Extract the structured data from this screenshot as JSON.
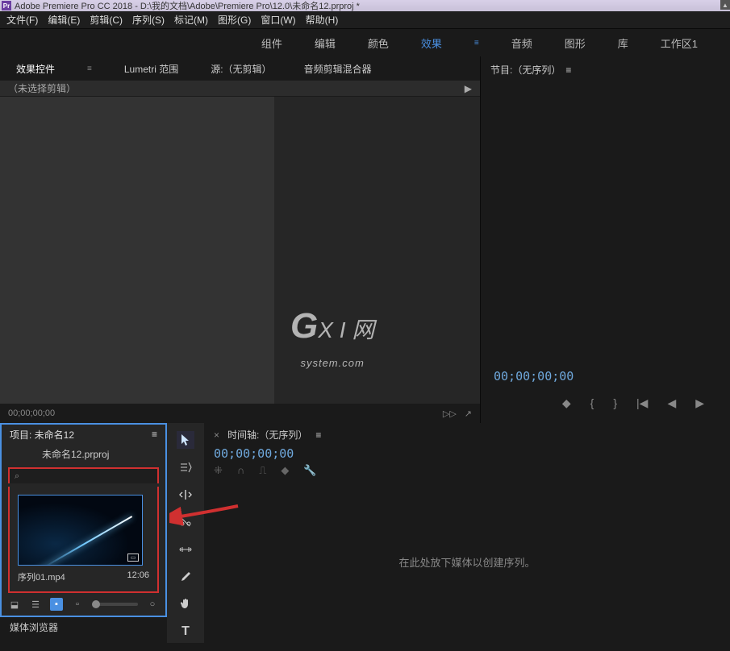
{
  "titlebar": {
    "app_badge": "Pr",
    "title": "Adobe Premiere Pro CC 2018 - D:\\我的文档\\Adobe\\Premiere Pro\\12.0\\未命名12.prproj *"
  },
  "menubar": {
    "file": "文件(F)",
    "edit": "编辑(E)",
    "clip": "剪辑(C)",
    "sequence": "序列(S)",
    "mark": "标记(M)",
    "graphic": "图形(G)",
    "window": "窗口(W)",
    "help": "帮助(H)"
  },
  "workspace": {
    "assembly": "组件",
    "editing": "编辑",
    "color": "颜色",
    "effects": "效果",
    "audio": "音频",
    "graphics": "图形",
    "library": "库",
    "workspace1": "工作区1"
  },
  "source_tabs": {
    "effect_controls": "效果控件",
    "lumetri": "Lumetri 范围",
    "source": "源:（无剪辑）",
    "audio_mixer": "音频剪辑混合器"
  },
  "effect_panel": {
    "no_clip": "（未选择剪辑）",
    "timecode": "00;00;00;00"
  },
  "program": {
    "title": "节目:（无序列）",
    "timecode": "00;00;00;00"
  },
  "project": {
    "title": "项目: 未命名12",
    "filename": "未命名12.prproj",
    "clip_name": "序列01.mp4",
    "clip_duration": "12:06"
  },
  "media_browser": "媒体浏览器",
  "timeline": {
    "title": "时间轴:（无序列）",
    "timecode": "00;00;00;00",
    "drop_hint": "在此处放下媒体以创建序列。"
  },
  "watermark": {
    "line1": "X I 网",
    "line2": "system.com"
  },
  "icons": {
    "triangle_right": "▶",
    "triangle_up": "▲",
    "hamburger": "≡",
    "magnifier": "⌕",
    "lock": "🔒",
    "list": "☰",
    "grid": "▦",
    "share": "↗",
    "marker_in": "{",
    "marker_out": "}",
    "step_back": "|◀",
    "prev": "◀",
    "play": "▶",
    "close_x": "×",
    "wrench": "🔧",
    "snap": "⌖"
  }
}
